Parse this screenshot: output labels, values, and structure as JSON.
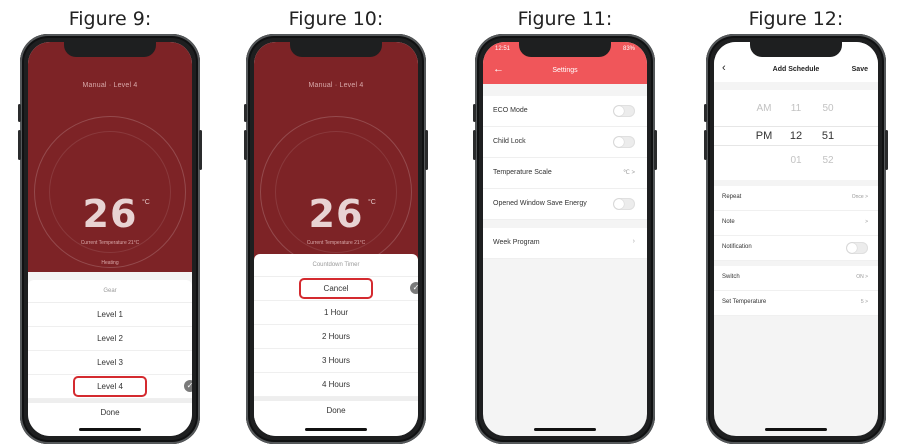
{
  "figures": {
    "fig9": {
      "caption": "Figure 9:",
      "mode_label": "Manual · Level 4",
      "temperature": "26",
      "unit": "°C",
      "current_label": "Current Temperature 21°C",
      "status": "Heating",
      "sheet_title": "Gear",
      "items": [
        "Level 1",
        "Level 2",
        "Level 3",
        "Level 4"
      ],
      "selected": "Level 4",
      "done": "Done"
    },
    "fig10": {
      "caption": "Figure 10:",
      "mode_label": "Manual · Level 4",
      "temperature": "26",
      "unit": "°C",
      "current_label": "Current Temperature 21°C",
      "sheet_title": "Countdown Timer",
      "items": [
        "Cancel",
        "1 Hour",
        "2 Hours",
        "3 Hours",
        "4 Hours"
      ],
      "selected": "Cancel",
      "done": "Done"
    },
    "fig11": {
      "caption": "Figure 11:",
      "time": "12:51",
      "battery": "83%",
      "title": "Settings",
      "back_icon": "arrow-left-icon",
      "rows": [
        {
          "label": "ECO Mode",
          "type": "toggle"
        },
        {
          "label": "Child Lock",
          "type": "toggle"
        },
        {
          "label": "Temperature Scale",
          "type": "value",
          "value": "℃ >"
        },
        {
          "label": "Opened Window Save Energy",
          "type": "toggle"
        }
      ],
      "week_program": "Week Program",
      "accent": "#f0565a"
    },
    "fig12": {
      "caption": "Figure 12:",
      "title": "Add Schedule",
      "save": "Save",
      "picker": {
        "row1": {
          "ampm": "AM",
          "hour": "11",
          "minute": "50"
        },
        "row2": {
          "ampm": "PM",
          "hour": "12",
          "minute": "51"
        },
        "row3": {
          "ampm": "",
          "hour": "01",
          "minute": "52"
        }
      },
      "rows1": [
        {
          "label": "Repeat",
          "value": "Once >"
        },
        {
          "label": "Note",
          "value": ">"
        },
        {
          "label": "Notification",
          "value": ""
        }
      ],
      "rows2": [
        {
          "label": "Switch",
          "value": "ON >"
        },
        {
          "label": "Set Temperature",
          "value": "5 >"
        }
      ]
    }
  }
}
